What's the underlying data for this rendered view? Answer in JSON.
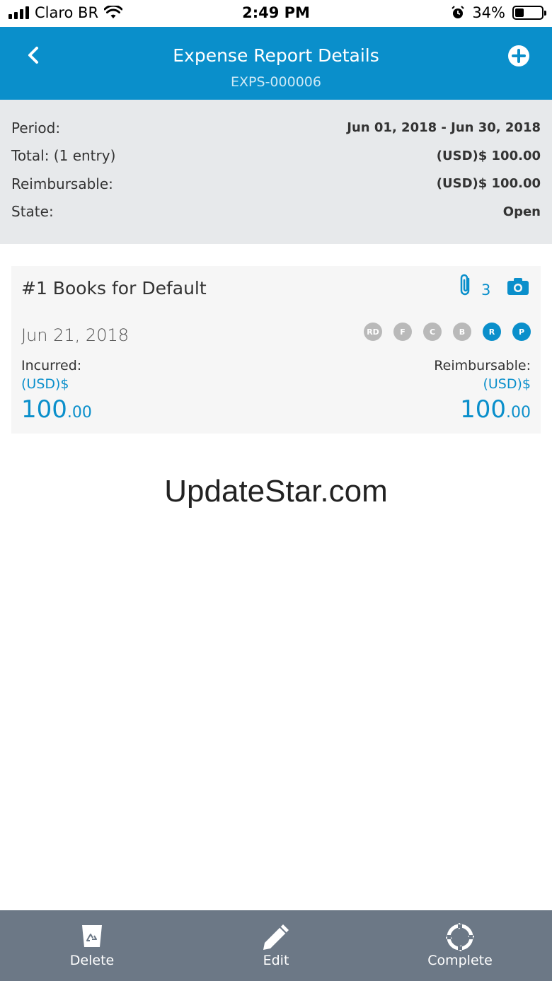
{
  "status_bar": {
    "carrier": "Claro BR",
    "time": "2:49 PM",
    "battery_percent": "34%",
    "battery_level": 0.34,
    "icons": [
      "signal-icon",
      "wifi-icon",
      "alarm-icon",
      "battery-icon"
    ]
  },
  "header": {
    "title": "Expense Report Details",
    "subtitle": "EXPS-000006",
    "back_icon": "chevron-left-icon",
    "add_icon": "plus-circle-icon",
    "color": "#0a8fcb"
  },
  "summary": {
    "rows": [
      {
        "label": "Period:",
        "value": "Jun 01, 2018 - Jun 30, 2018"
      },
      {
        "label": "Total: (1 entry)",
        "value": "(USD)$ 100.00"
      },
      {
        "label": "Reimbursable:",
        "value": "(USD)$ 100.00"
      },
      {
        "label": "State:",
        "value": "Open"
      }
    ]
  },
  "entry": {
    "title": "#1 Books for Default",
    "attachment_count": "3",
    "date": "Jun 21, 2018",
    "badges": [
      {
        "label": "RD",
        "active": false
      },
      {
        "label": "F",
        "active": false
      },
      {
        "label": "C",
        "active": false
      },
      {
        "label": "B",
        "active": false
      },
      {
        "label": "R",
        "active": true
      },
      {
        "label": "P",
        "active": true
      }
    ],
    "incurred": {
      "label": "Incurred:",
      "currency": "(USD)$",
      "whole": "100",
      "cents": ".00"
    },
    "reimbursable": {
      "label": "Reimbursable:",
      "currency": "(USD)$",
      "whole": "100",
      "cents": ".00"
    }
  },
  "watermark": "UpdateStar.com",
  "toolbar": {
    "delete_label": "Delete",
    "edit_label": "Edit",
    "complete_label": "Complete"
  }
}
